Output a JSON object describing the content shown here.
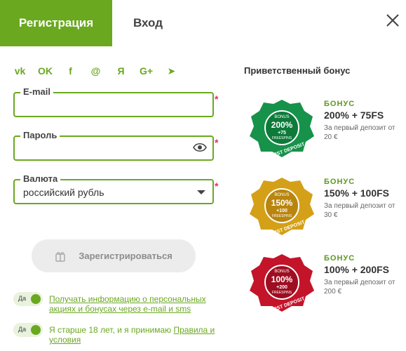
{
  "tabs": {
    "register": "Регистрация",
    "login": "Вход"
  },
  "social_icons": [
    "vk-icon",
    "odnoklassniki-icon",
    "facebook-icon",
    "mail-icon",
    "yandex-icon",
    "google-plus-icon",
    "telegram-icon"
  ],
  "social_glyphs": [
    "vk",
    "OK",
    "f",
    "@",
    "Я",
    "G+",
    "➤"
  ],
  "form": {
    "email_label": "E-mail",
    "password_label": "Пароль",
    "currency_label": "Валюта",
    "currency_value": "российский рубль",
    "required_mark": "*"
  },
  "register_button": "Зарегистрироваться",
  "consents": [
    {
      "toggle": "Да",
      "text": "Получать информацию о персональных акциях и бонусах через e-mail и sms"
    },
    {
      "toggle": "Да",
      "text_before": "Я старше 18 лет, и я принимаю ",
      "link": "Правила и условия"
    }
  ],
  "bonus": {
    "title": "Приветственный бонус",
    "items": [
      {
        "badge_top": "BONUS",
        "badge_pct": "200%",
        "badge_spins": "+75",
        "badge_fs": "FREESPINS",
        "badge_ribbon": "FIRST DEPOSIT",
        "color": "#17924b",
        "label": "БОНУС",
        "value": "200% + 75FS",
        "desc": "За первый депозит от 20 €"
      },
      {
        "badge_top": "BONUS",
        "badge_pct": "150%",
        "badge_spins": "+100",
        "badge_fs": "FREESPINS",
        "badge_ribbon": "FIRST DEPOSIT",
        "color": "#d4a018",
        "label": "БОНУС",
        "value": "150% + 100FS",
        "desc": "За первый депозит от 30 €"
      },
      {
        "badge_top": "BONUS",
        "badge_pct": "100%",
        "badge_spins": "+200",
        "badge_fs": "FREESPINS",
        "badge_ribbon": "FIRST DEPOSIT",
        "color": "#c4142a",
        "label": "БОНУС",
        "value": "100% + 200FS",
        "desc": "За первый депозит от 200 €"
      }
    ]
  },
  "colors": {
    "accent": "#6aa820",
    "required": "#e0335a",
    "button_bg": "#ececec"
  }
}
